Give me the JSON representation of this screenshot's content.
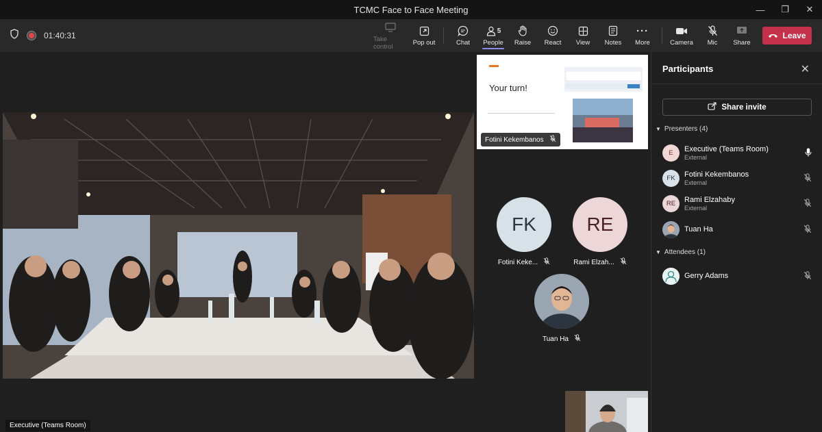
{
  "window": {
    "title": "TCMC Face to Face Meeting"
  },
  "toolbar": {
    "timer": "01:40:31",
    "buttons": {
      "take_control": "Take control",
      "pop_out": "Pop out",
      "chat": "Chat",
      "people": "People",
      "people_count": "5",
      "raise": "Raise",
      "react": "React",
      "view": "View",
      "notes": "Notes",
      "more": "More",
      "camera": "Camera",
      "mic": "Mic",
      "share": "Share"
    },
    "leave_label": "Leave",
    "leave_color": "#c4314b",
    "active_indicator_color": "#8b8cf0"
  },
  "stage": {
    "main_video_label": "Executive (Teams Room)",
    "shared_content": {
      "slide_text": "Your turn!",
      "presenter_name": "Fotini Kekembanos"
    },
    "tiles": [
      {
        "initials": "FK",
        "name": "Fotini Keke...",
        "bg": "#d6e1e8",
        "fg": "#2a3642"
      },
      {
        "initials": "RE",
        "name": "Rami Elzah...",
        "bg": "#ecd6d8",
        "fg": "#4a1f25"
      },
      {
        "initials": "",
        "name": "Tuan Ha",
        "bg": "#8a95a3",
        "fg": "#ffffff"
      }
    ]
  },
  "participants": {
    "title": "Participants",
    "share_invite": "Share invite",
    "presenters_label": "Presenters (4)",
    "attendees_label": "Attendees (1)",
    "presenters": [
      {
        "initials": "E",
        "name": "Executive (Teams Room)",
        "sub": "External",
        "bg": "#f1d8d4",
        "mic": "on"
      },
      {
        "initials": "FK",
        "name": "Fotini Kekembanos",
        "sub": "External",
        "bg": "#d6e1e8",
        "mic": "off"
      },
      {
        "initials": "RE",
        "name": "Rami Elzahaby",
        "sub": "External",
        "bg": "#ecd6d8",
        "mic": "off"
      },
      {
        "initials": "",
        "name": "Tuan Ha",
        "sub": "",
        "bg": "#8a95a3",
        "mic": "off"
      }
    ],
    "attendees": [
      {
        "initials": "",
        "name": "Gerry Adams",
        "sub": "",
        "bg": "#eaf4f4",
        "mic": "off"
      }
    ]
  }
}
